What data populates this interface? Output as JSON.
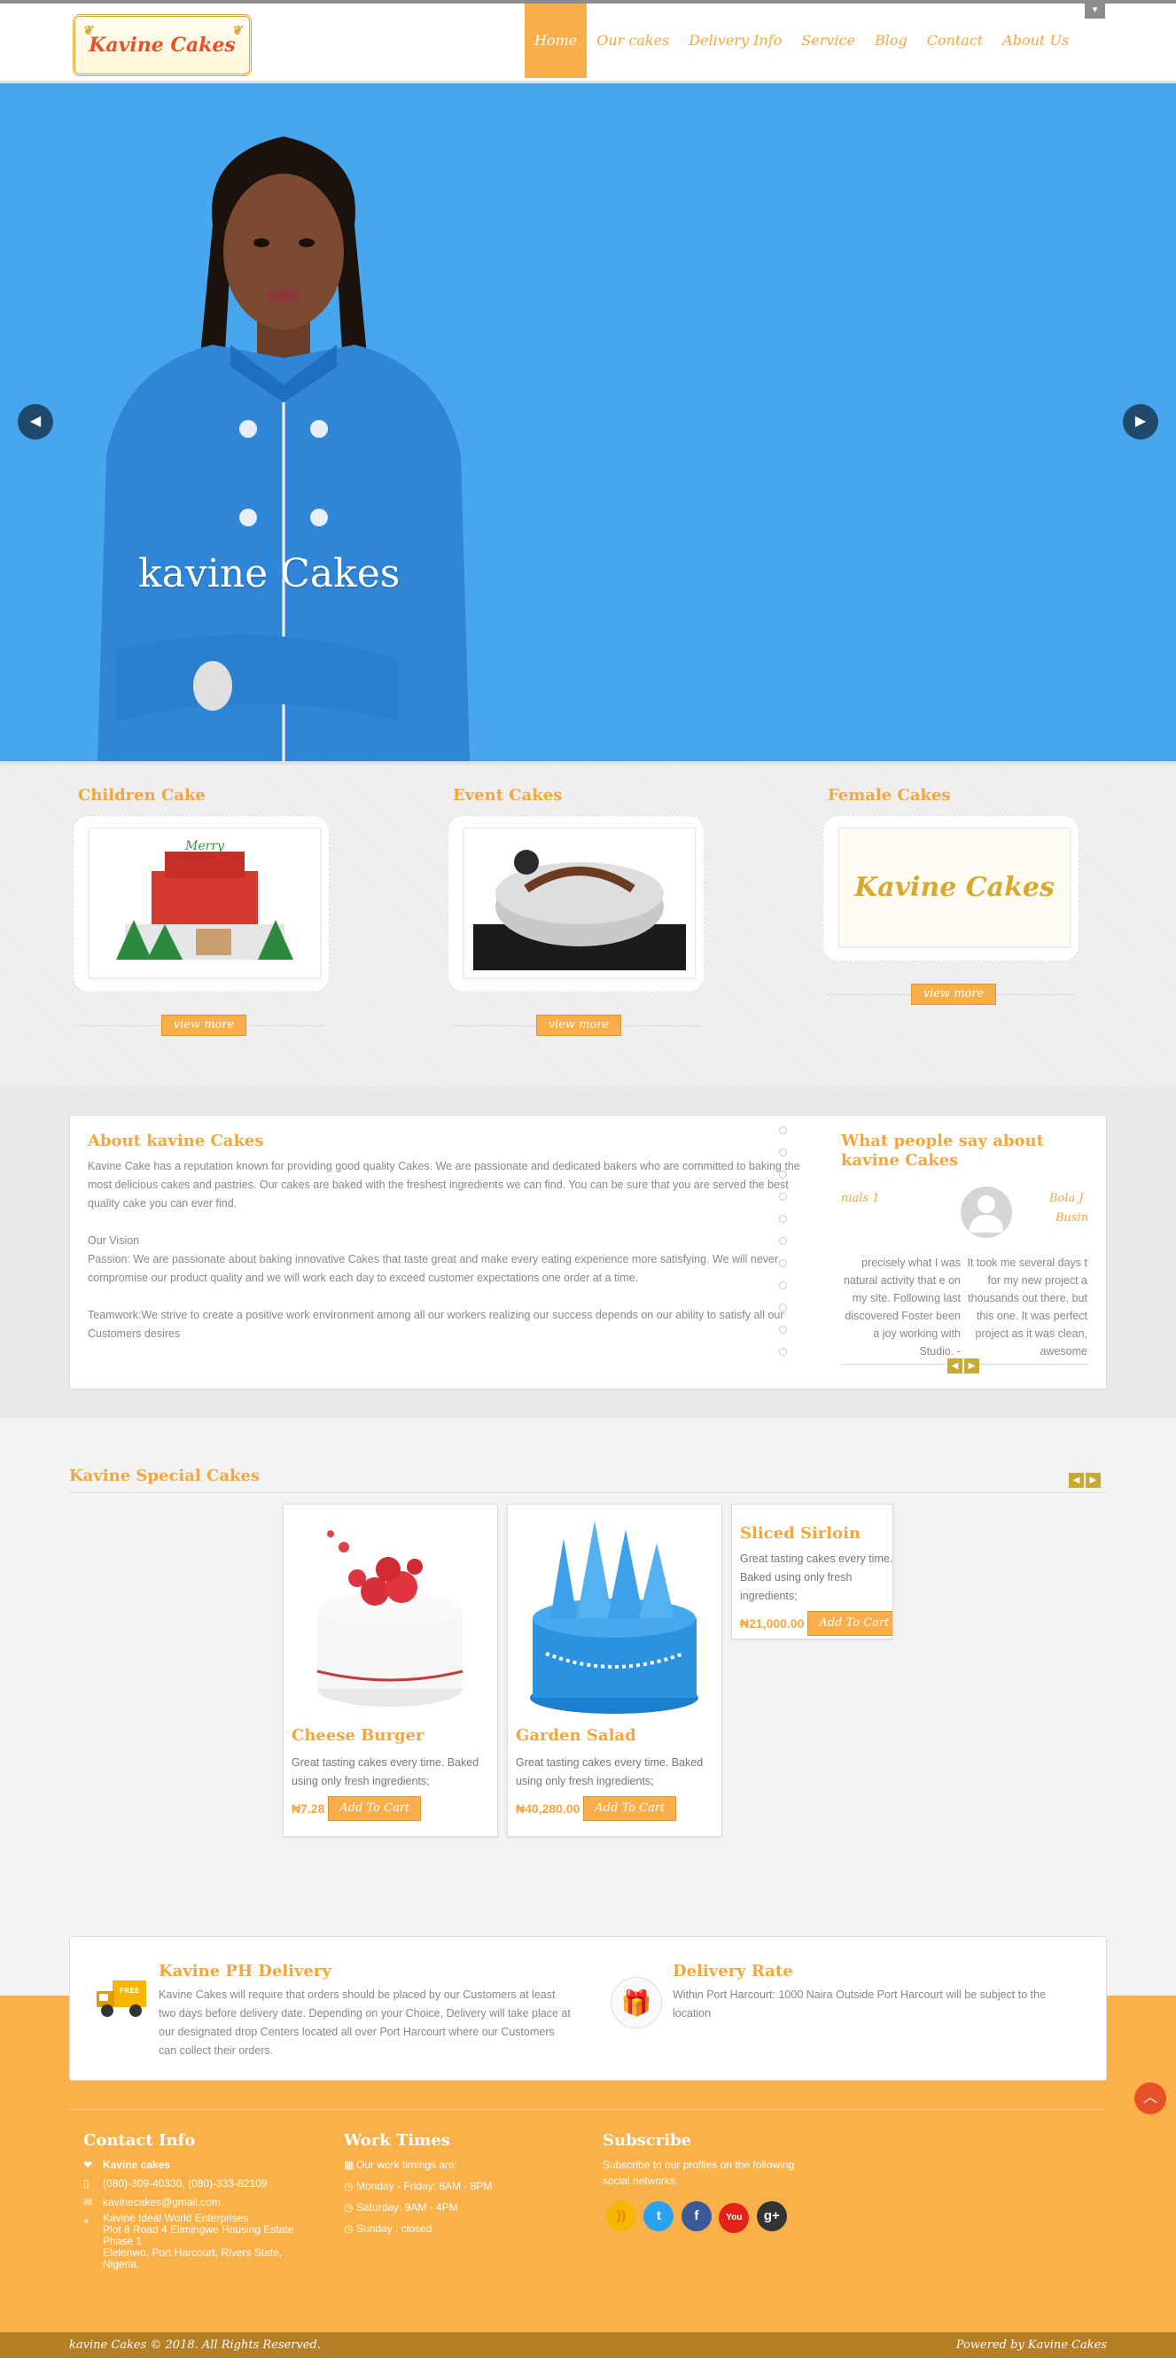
{
  "brand": {
    "logo_text": "Kavine Cakes"
  },
  "nav": {
    "items": [
      {
        "label": "Home"
      },
      {
        "label": "Our cakes"
      },
      {
        "label": "Delivery Info"
      },
      {
        "label": "Service"
      },
      {
        "label": "Blog"
      },
      {
        "label": "Contact"
      },
      {
        "label": "About Us"
      }
    ],
    "active": "Home"
  },
  "hero": {
    "caption": "kavine Cakes"
  },
  "categories": [
    {
      "title": "Children Cake",
      "button": "view more"
    },
    {
      "title": "Event Cakes",
      "button": "view more"
    },
    {
      "title": "Female Cakes",
      "button": "view more",
      "image_text": "Kavine Cakes"
    }
  ],
  "about": {
    "title": "About kavine Cakes",
    "intro": "Kavine Cake has a reputation known for providing good quality Cakes. We are passionate and dedicated bakers who are committed to baking the most delicious cakes and pastries. Our cakes are baked with the freshest ingredients we can find. You can be sure that you are served the best quality cake you can ever find.",
    "vision_heading": "Our Vision",
    "vision": "Passion: We are passionate about baking innovative Cakes that taste great and make every eating experience more satisfying. We will never compromise our product quality and we will work each day to exceed customer expectations one order at a time.",
    "teamwork": "Teamwork:We strive to create a positive work environment among all our workers realizing our success depends on our ability to satisfy all our Customers desires"
  },
  "testimonials": {
    "title": "What people say about kavine Cakes",
    "left_label": "nials 1",
    "author_name": "Bola J",
    "author_role": "Busin",
    "left_text": "precisely what I was natural activity that e on my site. Following last discovered Foster been a joy working with Studio. -",
    "right_text": "It took me several days t for my new project a thousands out there, but this one. It was perfect project as it was clean, awesome"
  },
  "special": {
    "title": "Kavine Special Cakes",
    "products": [
      {
        "name": "Cheese Burger",
        "desc": "Great tasting cakes every time. Baked using only fresh ingredients;",
        "price": "₦7.28",
        "button": "Add To Cart"
      },
      {
        "name": "Garden Salad",
        "desc": "Great tasting cakes every time. Baked using only fresh ingredients;",
        "price": "₦40,280.00",
        "button": "Add To Cart"
      },
      {
        "name": "Sliced Sirloin",
        "desc": "Great tasting cakes every time. Baked using only fresh ingredients;",
        "price": "₦21,000.00",
        "button": "Add To Cart"
      }
    ]
  },
  "delivery": {
    "ph_title": "Kavine PH Delivery",
    "ph_text": "Kavine Cakes will require that orders should be placed by our Customers at least two days before delivery date. Depending on your Choice, Delivery will take place at our designated drop Centers located all over Port Harcourt where our Customers can collect their orders.",
    "truck_label": "FREE",
    "rate_title": "Delivery Rate",
    "rate_text": "Within Port Harcourt: 1000 Naira Outside Port Harcourt will be subject to the location"
  },
  "footer": {
    "contact": {
      "title": "Contact Info",
      "name": "Kavine cakes",
      "phone": "(080)-309-40330, (080)-333-82109",
      "email": "kavinecakes@gmail.com",
      "address_1": "Kavine Ideal World Enterprises",
      "address_2": "Plot 8 Road 4 Elimingwe Housing Estate",
      "address_3": "Phase 1",
      "address_4": "Elelenwo, Port Harcourt, Rivers State,",
      "address_5": "Nigeria."
    },
    "work": {
      "title": "Work Times",
      "intro": "Our work timings are:",
      "weekday": "Monday - Friday: 8AM - 8PM",
      "saturday": "Saturday: 9AM - 4PM",
      "sunday": "Sunday : closed"
    },
    "subscribe": {
      "title": "Subscribe",
      "text": "Subscribe to our profiles on the following social networks.",
      "icons": [
        "rss-icon",
        "twitter-icon",
        "facebook-icon",
        "youtube-icon",
        "google-plus-icon"
      ],
      "glyphs": {
        "rss": "))",
        "twitter": "t",
        "facebook": "f",
        "youtube": "You",
        "gplus": "g+"
      }
    },
    "copyright": "kavine Cakes © 2018. All Rights Reserved.",
    "powered": "Powered by Kavine Cakes"
  },
  "colors": {
    "accent": "#f8ae4a",
    "hero_bg": "#48a6ee",
    "footer_bg": "#fab14a",
    "bottom_bar": "#b47f26"
  }
}
